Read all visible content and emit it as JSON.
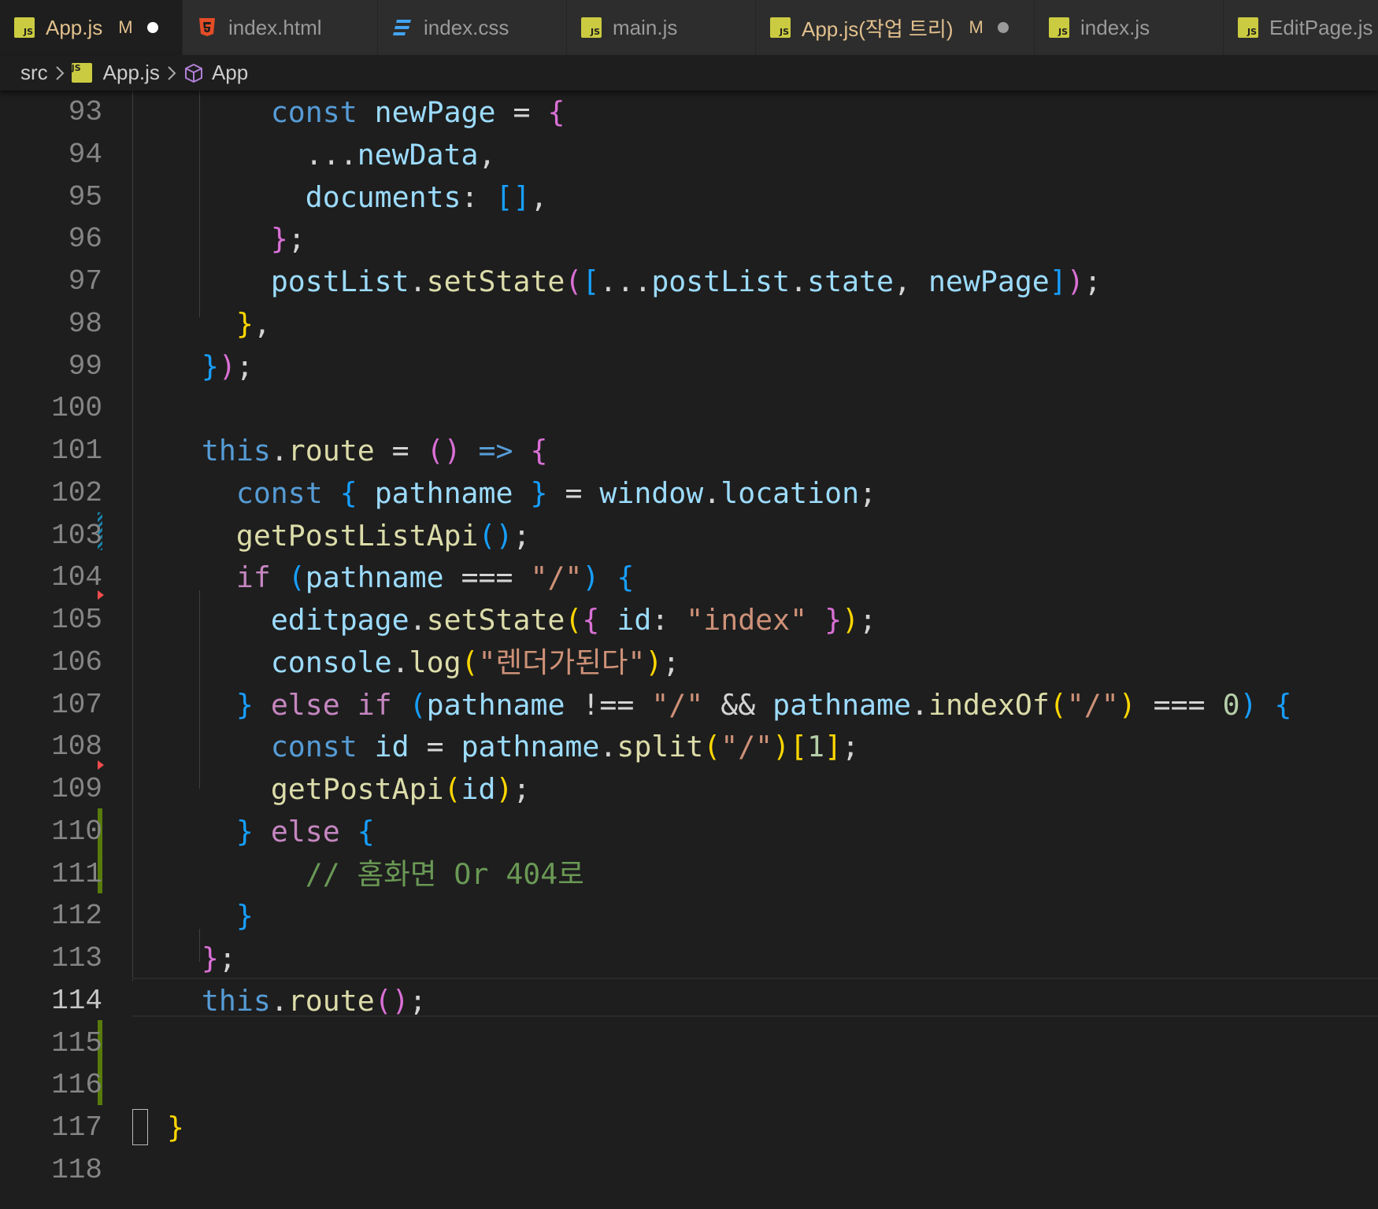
{
  "tabs": [
    {
      "label": "App.js",
      "icon": "js-file-icon",
      "status": "M",
      "dirty": true,
      "active": true
    },
    {
      "label": "index.html",
      "icon": "html-file-icon"
    },
    {
      "label": "index.css",
      "icon": "css-file-icon"
    },
    {
      "label": "main.js",
      "icon": "js-file-icon"
    },
    {
      "label": "App.js(작업 트리)",
      "icon": "js-file-icon",
      "status": "M",
      "dirty": true
    },
    {
      "label": "index.js",
      "icon": "js-file-icon"
    },
    {
      "label": "EditPage.js",
      "icon": "js-file-icon"
    }
  ],
  "breadcrumb": {
    "folder": "src",
    "file": "App.js",
    "symbol": "App"
  },
  "editor": {
    "current_line": 114,
    "lines": [
      {
        "num": "93",
        "tokens": [
          [
            "",
            "        "
          ],
          [
            "k",
            "const"
          ],
          [
            "t",
            " "
          ],
          [
            "v",
            "newPage"
          ],
          [
            "t",
            " = "
          ],
          [
            "b2",
            "{"
          ]
        ]
      },
      {
        "num": "94",
        "tokens": [
          [
            "",
            "          "
          ],
          [
            "t",
            "..."
          ],
          [
            "v",
            "newData"
          ],
          [
            "t",
            ","
          ]
        ]
      },
      {
        "num": "95",
        "tokens": [
          [
            "",
            "          "
          ],
          [
            "v",
            "documents"
          ],
          [
            "t",
            ": "
          ],
          [
            "b3",
            "[]"
          ],
          [
            "t",
            ","
          ]
        ]
      },
      {
        "num": "96",
        "tokens": [
          [
            "",
            "        "
          ],
          [
            "b2",
            "}"
          ],
          [
            "t",
            ";"
          ]
        ]
      },
      {
        "num": "97",
        "tokens": [
          [
            "",
            "        "
          ],
          [
            "v",
            "postList"
          ],
          [
            "t",
            "."
          ],
          [
            "f",
            "setState"
          ],
          [
            "b2",
            "("
          ],
          [
            "b3",
            "["
          ],
          [
            "t",
            "..."
          ],
          [
            "v",
            "postList"
          ],
          [
            "t",
            "."
          ],
          [
            "v",
            "state"
          ],
          [
            "t",
            ", "
          ],
          [
            "v",
            "newPage"
          ],
          [
            "b3",
            "]"
          ],
          [
            "b2",
            ")"
          ],
          [
            "t",
            ";"
          ]
        ]
      },
      {
        "num": "98",
        "tokens": [
          [
            "",
            "      "
          ],
          [
            "b1",
            "}"
          ],
          [
            "t",
            ","
          ]
        ]
      },
      {
        "num": "99",
        "tokens": [
          [
            "",
            "    "
          ],
          [
            "b3",
            "}"
          ],
          [
            "b2",
            ")"
          ],
          [
            "t",
            ";"
          ]
        ]
      },
      {
        "num": "100",
        "tokens": []
      },
      {
        "num": "101",
        "tokens": [
          [
            "",
            "    "
          ],
          [
            "k",
            "this"
          ],
          [
            "t",
            "."
          ],
          [
            "f",
            "route"
          ],
          [
            "t",
            " = "
          ],
          [
            "b2",
            "()"
          ],
          [
            "t",
            " "
          ],
          [
            "k",
            "=>"
          ],
          [
            "t",
            " "
          ],
          [
            "b2",
            "{"
          ]
        ]
      },
      {
        "num": "102",
        "tokens": [
          [
            "",
            "      "
          ],
          [
            "k",
            "const"
          ],
          [
            "t",
            " "
          ],
          [
            "b3",
            "{"
          ],
          [
            "t",
            " "
          ],
          [
            "v",
            "pathname"
          ],
          [
            "t",
            " "
          ],
          [
            "b3",
            "}"
          ],
          [
            "t",
            " = "
          ],
          [
            "v",
            "window"
          ],
          [
            "t",
            "."
          ],
          [
            "v",
            "location"
          ],
          [
            "t",
            ";"
          ]
        ]
      },
      {
        "num": "103",
        "tokens": [
          [
            "",
            "      "
          ],
          [
            "f",
            "getPostListApi"
          ],
          [
            "b3",
            "()"
          ],
          [
            "t",
            ";"
          ]
        ]
      },
      {
        "num": "104",
        "tokens": [
          [
            "",
            "      "
          ],
          [
            "p",
            "if"
          ],
          [
            "t",
            " "
          ],
          [
            "b3",
            "("
          ],
          [
            "v",
            "pathname"
          ],
          [
            "t",
            " === "
          ],
          [
            "s",
            "\"/\""
          ],
          [
            "b3",
            ")"
          ],
          [
            "t",
            " "
          ],
          [
            "b3",
            "{"
          ]
        ]
      },
      {
        "num": "105",
        "tokens": [
          [
            "",
            "        "
          ],
          [
            "v",
            "editpage"
          ],
          [
            "t",
            "."
          ],
          [
            "f",
            "setState"
          ],
          [
            "b1",
            "("
          ],
          [
            "b2",
            "{"
          ],
          [
            "t",
            " "
          ],
          [
            "v",
            "id"
          ],
          [
            "t",
            ": "
          ],
          [
            "s",
            "\"index\""
          ],
          [
            "t",
            " "
          ],
          [
            "b2",
            "}"
          ],
          [
            "b1",
            ")"
          ],
          [
            "t",
            ";"
          ]
        ]
      },
      {
        "num": "106",
        "tokens": [
          [
            "",
            "        "
          ],
          [
            "v",
            "console"
          ],
          [
            "t",
            "."
          ],
          [
            "f",
            "log"
          ],
          [
            "b1",
            "("
          ],
          [
            "s",
            "\"렌더가된다\""
          ],
          [
            "b1",
            ")"
          ],
          [
            "t",
            ";"
          ]
        ]
      },
      {
        "num": "107",
        "tokens": [
          [
            "",
            "      "
          ],
          [
            "b3",
            "}"
          ],
          [
            "t",
            " "
          ],
          [
            "p",
            "else"
          ],
          [
            "t",
            " "
          ],
          [
            "p",
            "if"
          ],
          [
            "t",
            " "
          ],
          [
            "b3",
            "("
          ],
          [
            "v",
            "pathname"
          ],
          [
            "t",
            " !== "
          ],
          [
            "s",
            "\"/\""
          ],
          [
            "t",
            " && "
          ],
          [
            "v",
            "pathname"
          ],
          [
            "t",
            "."
          ],
          [
            "f",
            "indexOf"
          ],
          [
            "b1",
            "("
          ],
          [
            "s",
            "\"/\""
          ],
          [
            "b1",
            ")"
          ],
          [
            "t",
            " === "
          ],
          [
            "n",
            "0"
          ],
          [
            "b3",
            ")"
          ],
          [
            "t",
            " "
          ],
          [
            "b3",
            "{"
          ]
        ]
      },
      {
        "num": "108",
        "tokens": [
          [
            "",
            "        "
          ],
          [
            "k",
            "const"
          ],
          [
            "t",
            " "
          ],
          [
            "v",
            "id"
          ],
          [
            "t",
            " = "
          ],
          [
            "v",
            "pathname"
          ],
          [
            "t",
            "."
          ],
          [
            "f",
            "split"
          ],
          [
            "b1",
            "("
          ],
          [
            "s",
            "\"/\""
          ],
          [
            "b1",
            ")"
          ],
          [
            "b1",
            "["
          ],
          [
            "n",
            "1"
          ],
          [
            "b1",
            "]"
          ],
          [
            "t",
            ";"
          ]
        ]
      },
      {
        "num": "109",
        "tokens": [
          [
            "",
            "        "
          ],
          [
            "f",
            "getPostApi"
          ],
          [
            "b1",
            "("
          ],
          [
            "v",
            "id"
          ],
          [
            "b1",
            ")"
          ],
          [
            "t",
            ";"
          ]
        ]
      },
      {
        "num": "110",
        "tokens": [
          [
            "",
            "      "
          ],
          [
            "b3",
            "}"
          ],
          [
            "t",
            " "
          ],
          [
            "p",
            "else"
          ],
          [
            "t",
            " "
          ],
          [
            "b3",
            "{"
          ]
        ]
      },
      {
        "num": "111",
        "tokens": [
          [
            "",
            "          "
          ],
          [
            "c",
            "// 홈화면 Or 404로"
          ]
        ]
      },
      {
        "num": "112",
        "tokens": [
          [
            "",
            "      "
          ],
          [
            "b3",
            "}"
          ]
        ]
      },
      {
        "num": "113",
        "tokens": [
          [
            "",
            "    "
          ],
          [
            "b2",
            "}"
          ],
          [
            "t",
            ";"
          ]
        ]
      },
      {
        "num": "114",
        "tokens": [
          [
            "",
            "    "
          ],
          [
            "k",
            "this"
          ],
          [
            "t",
            "."
          ],
          [
            "f",
            "route"
          ],
          [
            "b2",
            "()"
          ],
          [
            "t",
            ";"
          ]
        ]
      },
      {
        "num": "115",
        "tokens": []
      },
      {
        "num": "116",
        "tokens": []
      },
      {
        "num": "117",
        "tokens": [
          [
            "",
            "  "
          ],
          [
            "b1",
            "}"
          ]
        ]
      },
      {
        "num": "118",
        "tokens": []
      }
    ]
  },
  "colors": {
    "background": "#1e1e1e",
    "keyword": "#569cd6",
    "control": "#c586c0",
    "variable": "#9cdcfe",
    "function": "#dcdcaa",
    "string": "#ce9178",
    "number": "#b5cea8",
    "comment": "#6a9955",
    "bracket_gold": "#ffd700",
    "bracket_orchid": "#da70d6",
    "bracket_blue": "#179fff",
    "git_added": "#587c0c",
    "git_modified": "#1b81a8",
    "git_deleted": "#f14c4c"
  }
}
